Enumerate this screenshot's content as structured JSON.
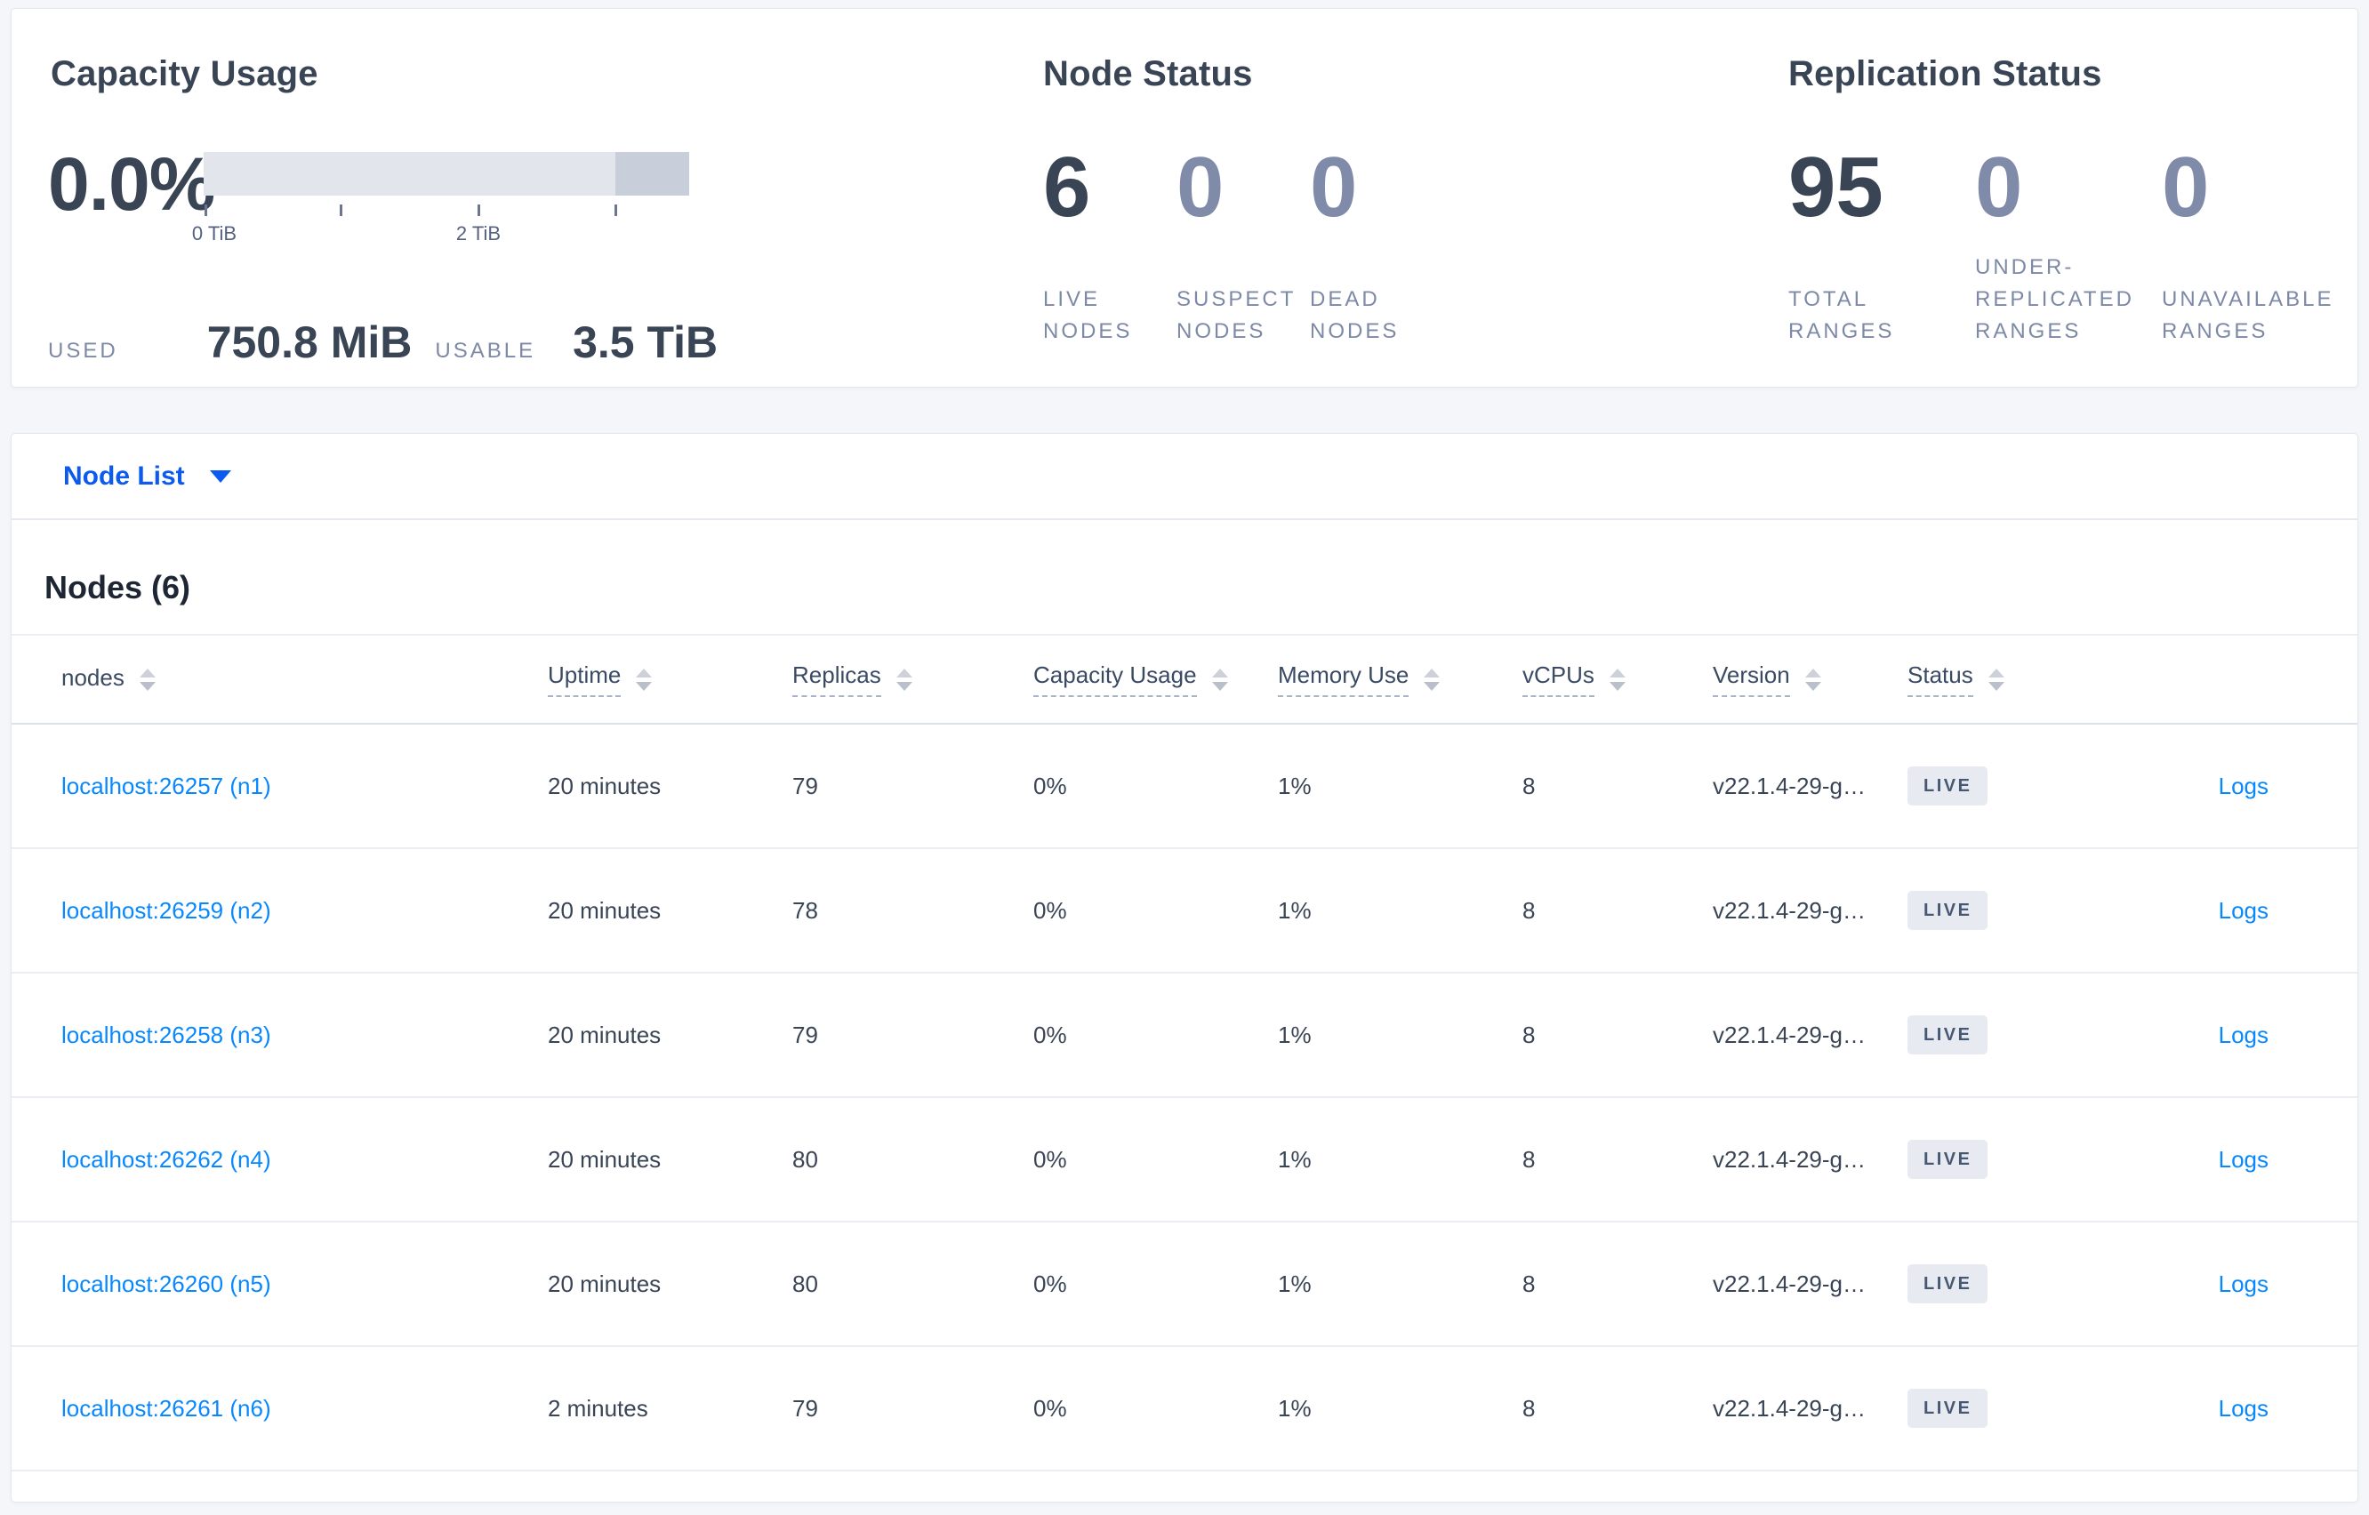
{
  "colors": {
    "page_bg": "#f4f6fa",
    "card_bg": "#ffffff",
    "text_dark": "#394455",
    "text_heading": "#1f2633",
    "text_muted": "#7d89a6",
    "stat_dim": "#7f8ba9",
    "link_blue": "#0788ff",
    "dropdown_blue": "#0d5af1",
    "badge_bg": "#e7eaf1",
    "badge_text": "#475872",
    "bar_track": "#e2e5ec",
    "bar_segment": "#c9cedb"
  },
  "capacity_panel": {
    "title": "Capacity Usage",
    "percent": "0.0%",
    "tick_label_0": "0 TiB",
    "tick_label_2": "2 TiB",
    "used_label": "USED",
    "used_value": "750.8 MiB",
    "usable_label": "USABLE",
    "usable_value": "3.5 TiB"
  },
  "node_status_panel": {
    "title": "Node Status",
    "stats": [
      {
        "value": "6",
        "label": "LIVE NODES"
      },
      {
        "value": "0",
        "label": "SUSPECT NODES"
      },
      {
        "value": "0",
        "label": "DEAD NODES"
      }
    ]
  },
  "replication_panel": {
    "title": "Replication Status",
    "stats": [
      {
        "value": "95",
        "label": "TOTAL RANGES"
      },
      {
        "value": "0",
        "label": "UNDER-REPLICATED RANGES"
      },
      {
        "value": "0",
        "label": "UNAVAILABLE RANGES"
      }
    ]
  },
  "view_selector": {
    "label": "Node List",
    "icon": "caret-down-icon"
  },
  "nodes_table": {
    "title": "Nodes (6)",
    "columns": [
      {
        "label": "nodes",
        "sortable": true,
        "tooltip_underline": false
      },
      {
        "label": "Uptime",
        "sortable": true,
        "tooltip_underline": true
      },
      {
        "label": "Replicas",
        "sortable": true,
        "tooltip_underline": true
      },
      {
        "label": "Capacity Usage",
        "sortable": true,
        "tooltip_underline": true
      },
      {
        "label": "Memory Use",
        "sortable": true,
        "tooltip_underline": true
      },
      {
        "label": "vCPUs",
        "sortable": true,
        "tooltip_underline": true
      },
      {
        "label": "Version",
        "sortable": true,
        "tooltip_underline": true
      },
      {
        "label": "Status",
        "sortable": true,
        "tooltip_underline": true
      }
    ],
    "sort_icon": "sort-arrows-icon",
    "logs_label": "Logs",
    "rows": [
      {
        "node": "localhost:26257 (n1)",
        "uptime": "20 minutes",
        "replicas": "79",
        "capacity_usage": "0%",
        "memory_use": "1%",
        "vcpus": "8",
        "version": "v22.1.4-29-g…",
        "status": "LIVE"
      },
      {
        "node": "localhost:26259 (n2)",
        "uptime": "20 minutes",
        "replicas": "78",
        "capacity_usage": "0%",
        "memory_use": "1%",
        "vcpus": "8",
        "version": "v22.1.4-29-g…",
        "status": "LIVE"
      },
      {
        "node": "localhost:26258 (n3)",
        "uptime": "20 minutes",
        "replicas": "79",
        "capacity_usage": "0%",
        "memory_use": "1%",
        "vcpus": "8",
        "version": "v22.1.4-29-g…",
        "status": "LIVE"
      },
      {
        "node": "localhost:26262 (n4)",
        "uptime": "20 minutes",
        "replicas": "80",
        "capacity_usage": "0%",
        "memory_use": "1%",
        "vcpus": "8",
        "version": "v22.1.4-29-g…",
        "status": "LIVE"
      },
      {
        "node": "localhost:26260 (n5)",
        "uptime": "20 minutes",
        "replicas": "80",
        "capacity_usage": "0%",
        "memory_use": "1%",
        "vcpus": "8",
        "version": "v22.1.4-29-g…",
        "status": "LIVE"
      },
      {
        "node": "localhost:26261 (n6)",
        "uptime": "2 minutes",
        "replicas": "79",
        "capacity_usage": "0%",
        "memory_use": "1%",
        "vcpus": "8",
        "version": "v22.1.4-29-g…",
        "status": "LIVE"
      }
    ]
  }
}
